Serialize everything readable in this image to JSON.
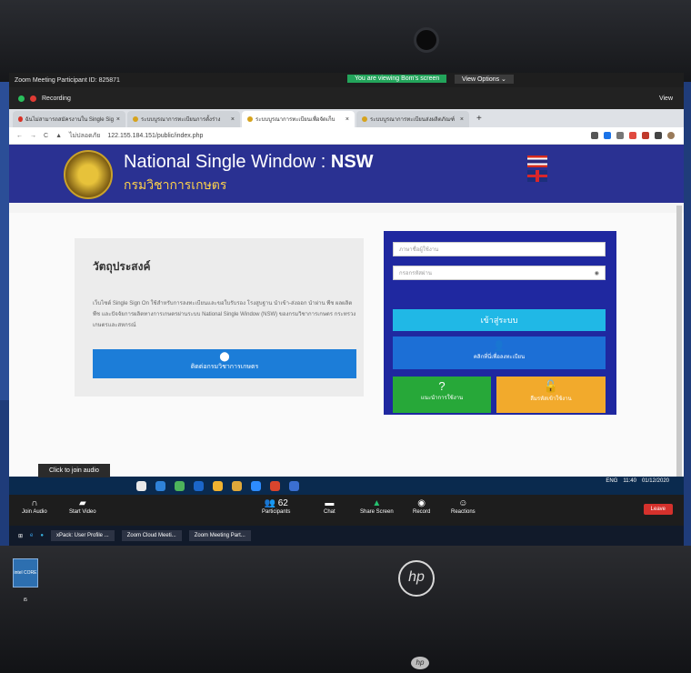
{
  "zoom": {
    "title": "Zoom Meeting Participant ID: 825871",
    "banner": "You are viewing Bom's screen",
    "view_options": "View Options ⌄",
    "recording": "Recording",
    "view": "View"
  },
  "browser": {
    "tabs": [
      {
        "label": "ฉันไม่สามารถสมัครงานใน Single Sig"
      },
      {
        "label": "ระบบบูรณาการทะเบียนการตั้งร่าง"
      },
      {
        "label": "ระบบบูรณาการทะเบียนเพื่อจัดเก็บ"
      },
      {
        "label": "ระบบบูรณาการทะเบียนส่งผลิตภัณฑ์"
      }
    ],
    "plus": "+",
    "security": "ไม่ปลอดภัย",
    "url": "122.155.184.151/public/index.php"
  },
  "site": {
    "title_main": "National Single Window : ",
    "title_bold": "NSW",
    "subtitle": "กรมวิชาการเกษตร"
  },
  "objective": {
    "title": "วัตถุประสงค์",
    "text": "เว็บไซต์ Single Sign On ใช้สำหรับการลงทะเบียนและขอใบรับรอง โรงสูบฐาน นำเข้า-ส่งออก นำผ่าน พืช ผลผลิตพืช และปัจจัยการผลิตทางการเกษตรผ่านระบบ National Single Window (NSW) ของกรมวิชาการเกษตร กระทรวงเกษตรและสหกรณ์",
    "contact_button": "ติดต่อกรมวิชาการเกษตร"
  },
  "login": {
    "username_placeholder": "ภาษาชื่อผู้ใช้งาน",
    "password_placeholder": "กรอกรหัสผ่าน",
    "login_button": "เข้าสู่ระบบ",
    "register_button": "คลิกที่นี่เพื่อลงทะเบียน",
    "guide_button": "แนะนำการใช้งาน",
    "forgot_button": "ลืมรหัสเข้าใช้งาน"
  },
  "tooltip": "Click to join audio",
  "tray": {
    "lang": "ENG",
    "time": "11:40",
    "date": "01/12/2020"
  },
  "zoom_controls": {
    "join_audio": "Join Audio",
    "start_video": "Start Video",
    "participants": "Participants",
    "participants_count": "62",
    "chat": "Chat",
    "share_screen": "Share Screen",
    "record": "Record",
    "reactions": "Reactions",
    "leave": "Leave"
  },
  "windows_taskbar": [
    {
      "label": "xPack: User Profile ..."
    },
    {
      "label": "Zoom Cloud Meeti..."
    },
    {
      "label": "Zoom Meeting Part..."
    }
  ],
  "laptop": {
    "intel": "intel CORE i5",
    "brand": "hp"
  },
  "colors": {
    "site_header": "#2a3192",
    "login_panel": "#1f28a0",
    "login_button": "#20b8e6",
    "guide_button": "#27a839",
    "forgot_button": "#f2aa2c",
    "leave_button": "#d5312c"
  }
}
